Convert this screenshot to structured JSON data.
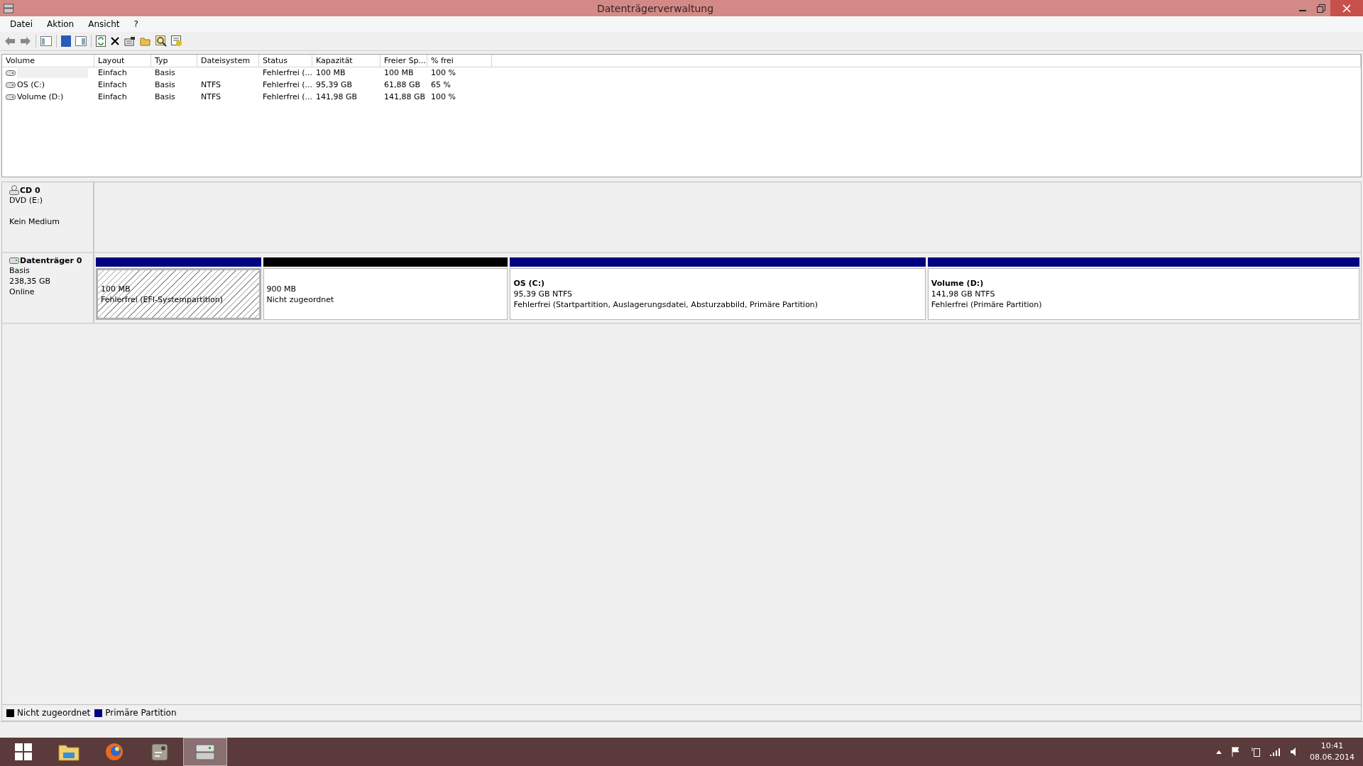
{
  "window": {
    "title": "Datenträgerverwaltung"
  },
  "menu": [
    "Datei",
    "Aktion",
    "Ansicht",
    "?"
  ],
  "table": {
    "columns": [
      "Volume",
      "Layout",
      "Typ",
      "Dateisystem",
      "Status",
      "Kapazität",
      "Freier Sp...",
      "% frei"
    ],
    "rows": [
      [
        "",
        "Einfach",
        "Basis",
        "",
        "Fehlerfrei (...",
        "100 MB",
        "100 MB",
        "100 %"
      ],
      [
        "OS (C:)",
        "Einfach",
        "Basis",
        "NTFS",
        "Fehlerfrei (...",
        "95,39 GB",
        "61,88 GB",
        "65 %"
      ],
      [
        "Volume (D:)",
        "Einfach",
        "Basis",
        "NTFS",
        "Fehlerfrei (...",
        "141,98 GB",
        "141,88 GB",
        "100 %"
      ]
    ]
  },
  "disks": [
    {
      "kind": "cdrom",
      "name": "CD 0",
      "lines": [
        "DVD (E:)",
        "Kein Medium"
      ]
    },
    {
      "kind": "disk",
      "name": "Datenträger 0",
      "lines": [
        "Basis",
        "238,35 GB",
        "Online"
      ],
      "partitions": [
        {
          "size": "100 MB",
          "status": "Fehlerfrei (EFI-Systempartition)",
          "color": "#000080",
          "selected": true
        },
        {
          "size": "900 MB",
          "status": "Nicht zugeordnet",
          "color": "#000000",
          "selected": false
        },
        {
          "title": "OS  (C:)",
          "size": "95,39 GB NTFS",
          "status": "Fehlerfrei (Startpartition, Auslagerungsdatei, Absturzabbild, Primäre Partition)",
          "color": "#000080",
          "selected": false
        },
        {
          "title": "Volume  (D:)",
          "size": "141,98 GB NTFS",
          "status": "Fehlerfrei (Primäre Partition)",
          "color": "#000080",
          "selected": false
        }
      ]
    }
  ],
  "legend": [
    {
      "label": "Nicht zugeordnet",
      "color": "#000000"
    },
    {
      "label": "Primäre Partition",
      "color": "#000080"
    }
  ],
  "taskbar": {
    "apps": [
      {
        "kind": "folder",
        "selected": false
      },
      {
        "kind": "browser",
        "selected": false
      },
      {
        "kind": "tool",
        "selected": false
      },
      {
        "kind": "disk",
        "selected": true
      }
    ],
    "time": "10:41",
    "date": "08.06.2014"
  }
}
